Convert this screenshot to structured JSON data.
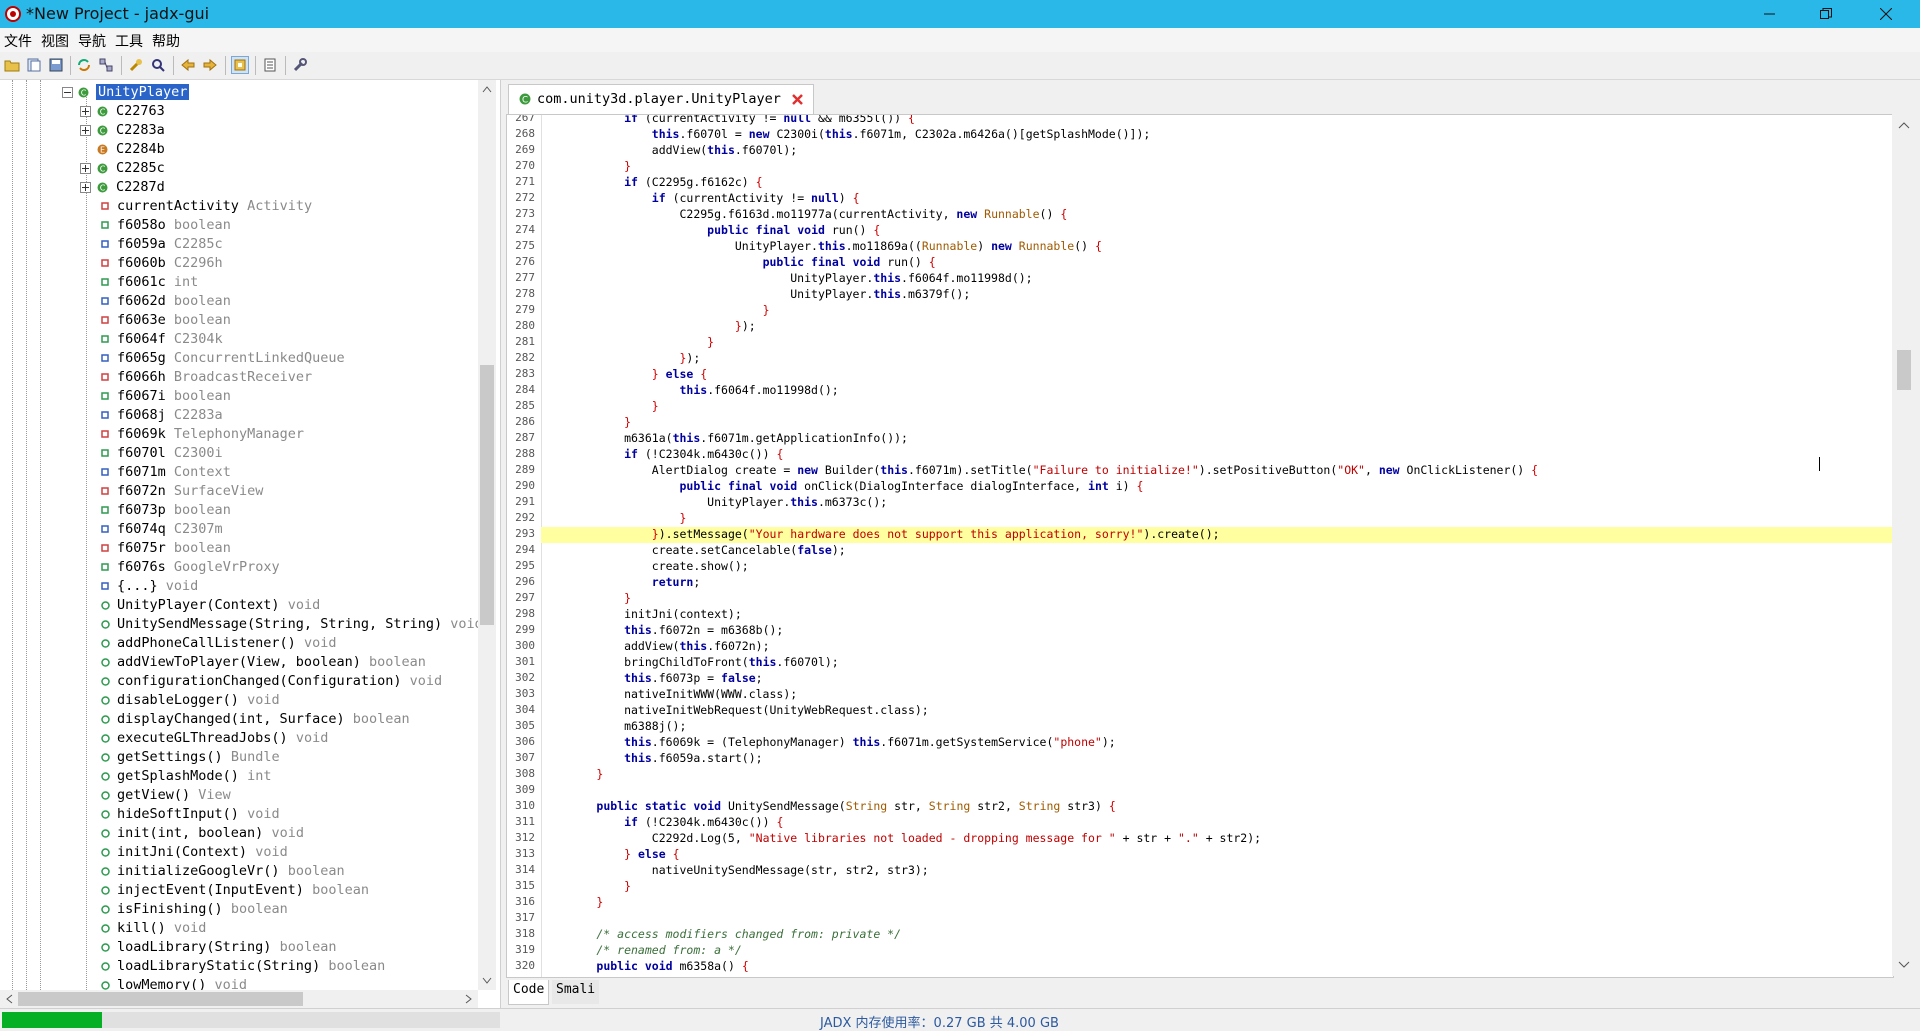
{
  "window": {
    "title": "*New Project - jadx-gui"
  },
  "menu": [
    "文件",
    "视图",
    "导航",
    "工具",
    "帮助"
  ],
  "tree": {
    "root": "UnityPlayer",
    "classes": [
      "C22763",
      "C2283a",
      "C2284b",
      "C2285c",
      "C2287d"
    ],
    "members": [
      {
        "name": "currentActivity",
        "type": "Activity"
      },
      {
        "name": "f6058o",
        "type": "boolean"
      },
      {
        "name": "f6059a",
        "type": "C2285c"
      },
      {
        "name": "f6060b",
        "type": "C2296h"
      },
      {
        "name": "f6061c",
        "type": "int"
      },
      {
        "name": "f6062d",
        "type": "boolean"
      },
      {
        "name": "f6063e",
        "type": "boolean"
      },
      {
        "name": "f6064f",
        "type": "C2304k"
      },
      {
        "name": "f6065g",
        "type": "ConcurrentLinkedQueue"
      },
      {
        "name": "f6066h",
        "type": "BroadcastReceiver"
      },
      {
        "name": "f6067i",
        "type": "boolean"
      },
      {
        "name": "f6068j",
        "type": "C2283a"
      },
      {
        "name": "f6069k",
        "type": "TelephonyManager"
      },
      {
        "name": "f6070l",
        "type": "C2300i"
      },
      {
        "name": "f6071m",
        "type": "Context"
      },
      {
        "name": "f6072n",
        "type": "SurfaceView"
      },
      {
        "name": "f6073p",
        "type": "boolean"
      },
      {
        "name": "f6074q",
        "type": "C2307m"
      },
      {
        "name": "f6075r",
        "type": "boolean"
      },
      {
        "name": "f6076s",
        "type": "GoogleVrProxy"
      },
      {
        "name": "{...}",
        "type": "void"
      },
      {
        "name": "UnityPlayer(Context)",
        "type": "void"
      },
      {
        "name": "UnitySendMessage(String, String, String)",
        "type": "void"
      },
      {
        "name": "addPhoneCallListener()",
        "type": "void"
      },
      {
        "name": "addViewToPlayer(View, boolean)",
        "type": "boolean"
      },
      {
        "name": "configurationChanged(Configuration)",
        "type": "void"
      },
      {
        "name": "disableLogger()",
        "type": "void"
      },
      {
        "name": "displayChanged(int, Surface)",
        "type": "boolean"
      },
      {
        "name": "executeGLThreadJobs()",
        "type": "void"
      },
      {
        "name": "getSettings()",
        "type": "Bundle"
      },
      {
        "name": "getSplashMode()",
        "type": "int"
      },
      {
        "name": "getView()",
        "type": "View"
      },
      {
        "name": "hideSoftInput()",
        "type": "void"
      },
      {
        "name": "init(int, boolean)",
        "type": "void"
      },
      {
        "name": "initJni(Context)",
        "type": "void"
      },
      {
        "name": "initializeGoogleVr()",
        "type": "boolean"
      },
      {
        "name": "injectEvent(InputEvent)",
        "type": "boolean"
      },
      {
        "name": "isFinishing()",
        "type": "boolean"
      },
      {
        "name": "kill()",
        "type": "void"
      },
      {
        "name": "loadLibrary(String)",
        "type": "boolean"
      },
      {
        "name": "loadLibraryStatic(String)",
        "type": "boolean"
      },
      {
        "name": "lowMemory()",
        "type": "void"
      }
    ]
  },
  "editor": {
    "tab_title": "com.unity3d.player.UnityPlayer",
    "bottom_tabs": [
      "Code",
      "Smali"
    ],
    "lines": [
      {
        "n": "267",
        "t": "            if (currentActivity != null && m6355l()) {"
      },
      {
        "n": "268",
        "t": "                this.f6070l = new C2300i(this.f6071m, C2302a.m6426a()[getSplashMode()]);"
      },
      {
        "n": "269",
        "t": "                addView(this.f6070l);"
      },
      {
        "n": "270",
        "t": "            }"
      },
      {
        "n": "271",
        "t": "            if (C2295g.f6162c) {"
      },
      {
        "n": "272",
        "t": "                if (currentActivity != null) {"
      },
      {
        "n": "273",
        "t": "                    C2295g.f6163d.mo11977a(currentActivity, new Runnable() {"
      },
      {
        "n": "274",
        "t": "                        public final void run() {"
      },
      {
        "n": "275",
        "t": "                            UnityPlayer.this.mo11869a((Runnable) new Runnable() {"
      },
      {
        "n": "276",
        "t": "                                public final void run() {"
      },
      {
        "n": "277",
        "t": "                                    UnityPlayer.this.f6064f.mo11998d();"
      },
      {
        "n": "278",
        "t": "                                    UnityPlayer.this.m6379f();"
      },
      {
        "n": "279",
        "t": "                                }"
      },
      {
        "n": "280",
        "t": "                            });"
      },
      {
        "n": "281",
        "t": "                        }"
      },
      {
        "n": "282",
        "t": "                    });"
      },
      {
        "n": "283",
        "t": "                } else {"
      },
      {
        "n": "284",
        "t": "                    this.f6064f.mo11998d();"
      },
      {
        "n": "285",
        "t": "                }"
      },
      {
        "n": "286",
        "t": "            }"
      },
      {
        "n": "287",
        "t": "            m6361a(this.f6071m.getApplicationInfo());"
      },
      {
        "n": "288",
        "t": "            if (!C2304k.m6430c()) {"
      },
      {
        "n": "289",
        "t": "                AlertDialog create = new Builder(this.f6071m).setTitle(\"Failure to initialize!\").setPositiveButton(\"OK\", new OnClickListener() {"
      },
      {
        "n": "290",
        "t": "                    public final void onClick(DialogInterface dialogInterface, int i) {"
      },
      {
        "n": "291",
        "t": "                        UnityPlayer.this.m6373c();"
      },
      {
        "n": "292",
        "t": "                    }"
      },
      {
        "n": "293",
        "t": "                }).setMessage(\"Your hardware does not support this application, sorry!\").create();"
      },
      {
        "n": "294",
        "t": "                create.setCancelable(false);"
      },
      {
        "n": "295",
        "t": "                create.show();"
      },
      {
        "n": "296",
        "t": "                return;"
      },
      {
        "n": "297",
        "t": "            }"
      },
      {
        "n": "298",
        "t": "            initJni(context);"
      },
      {
        "n": "299",
        "t": "            this.f6072n = m6368b();"
      },
      {
        "n": "300",
        "t": "            addView(this.f6072n);"
      },
      {
        "n": "301",
        "t": "            bringChildToFront(this.f6070l);"
      },
      {
        "n": "302",
        "t": "            this.f6073p = false;"
      },
      {
        "n": "303",
        "t": "            nativeInitWWW(WWW.class);"
      },
      {
        "n": "304",
        "t": "            nativeInitWebRequest(UnityWebRequest.class);"
      },
      {
        "n": "305",
        "t": "            m6388j();"
      },
      {
        "n": "306",
        "t": "            this.f6069k = (TelephonyManager) this.f6071m.getSystemService(\"phone\");"
      },
      {
        "n": "307",
        "t": "            this.f6059a.start();"
      },
      {
        "n": "308",
        "t": "        }"
      },
      {
        "n": "309",
        "t": ""
      },
      {
        "n": "310",
        "t": "        public static void UnitySendMessage(String str, String str2, String str3) {"
      },
      {
        "n": "311",
        "t": "            if (!C2304k.m6430c()) {"
      },
      {
        "n": "312",
        "t": "                C2292d.Log(5, \"Native libraries not loaded - dropping message for \" + str + \".\" + str2);"
      },
      {
        "n": "313",
        "t": "            } else {"
      },
      {
        "n": "314",
        "t": "                nativeUnitySendMessage(str, str2, str3);"
      },
      {
        "n": "315",
        "t": "            }"
      },
      {
        "n": "316",
        "t": "        }"
      },
      {
        "n": "317",
        "t": ""
      },
      {
        "n": "318",
        "t": "        /* access modifiers changed from: private */"
      },
      {
        "n": "319",
        "t": "        /* renamed from: a */"
      },
      {
        "n": "320",
        "t": "        public void m6358a() {"
      }
    ]
  },
  "status": {
    "memory_text": "JADX 内存使用率：0.27 GB 共 4.00 GB",
    "progress": 0.2
  }
}
